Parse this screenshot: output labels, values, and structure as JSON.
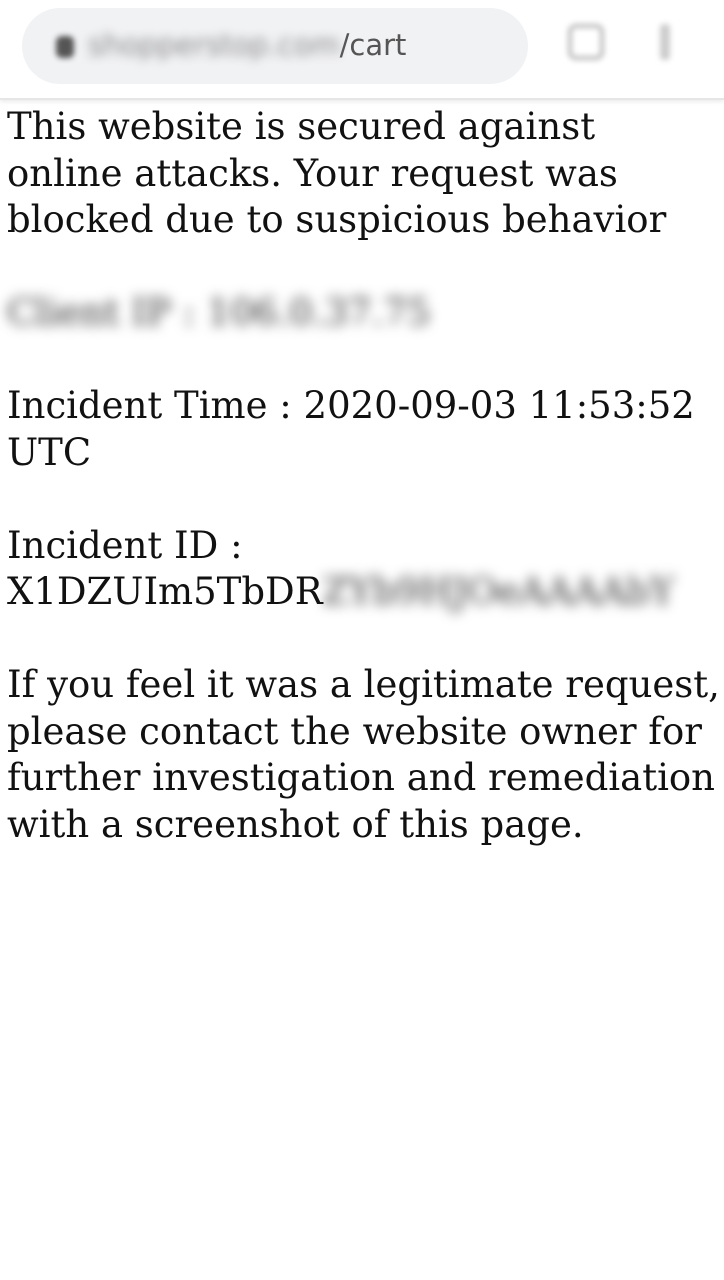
{
  "browser": {
    "url_domain": "shopperstop.com",
    "url_path": "/cart",
    "tabs_icon": "tabs-icon",
    "menu_icon": "more-vert-icon"
  },
  "page": {
    "intro": "This website is secured against online attacks. Your request was blocked due to suspicious behavior",
    "client_ip": "Client IP : 106.0.37.75",
    "incident_time_label": "Incident Time :",
    "incident_time_value": "2020-09-03 11:53:52 UTC",
    "incident_id_label": "Incident ID :",
    "incident_id_visible": "X1DZUIm5TbDR",
    "incident_id_blurred": "ZYb9HJOeAAAAbY",
    "footer": "If you feel it was a legitimate request, please contact the website owner for further investigation and remediation with a screenshot of this page."
  }
}
